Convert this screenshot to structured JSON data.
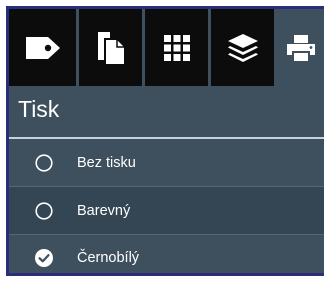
{
  "toolbar": {
    "tabs": [
      {
        "icon": "tag-icon",
        "active": false
      },
      {
        "icon": "copy-pages-icon",
        "active": false
      },
      {
        "icon": "grid-icon",
        "active": false
      },
      {
        "icon": "layers-icon",
        "active": false
      },
      {
        "icon": "printer-icon",
        "active": true
      }
    ]
  },
  "panel": {
    "title": "Tisk",
    "options": [
      {
        "label": "Bez tisku",
        "selected": false
      },
      {
        "label": "Barevný",
        "selected": false
      },
      {
        "label": "Černobílý",
        "selected": true
      }
    ]
  },
  "colors": {
    "frame": "#2a2d7a",
    "panel_bg": "#3e4f5e",
    "tab_bg": "#0c0c0c",
    "text": "#ffffff"
  }
}
